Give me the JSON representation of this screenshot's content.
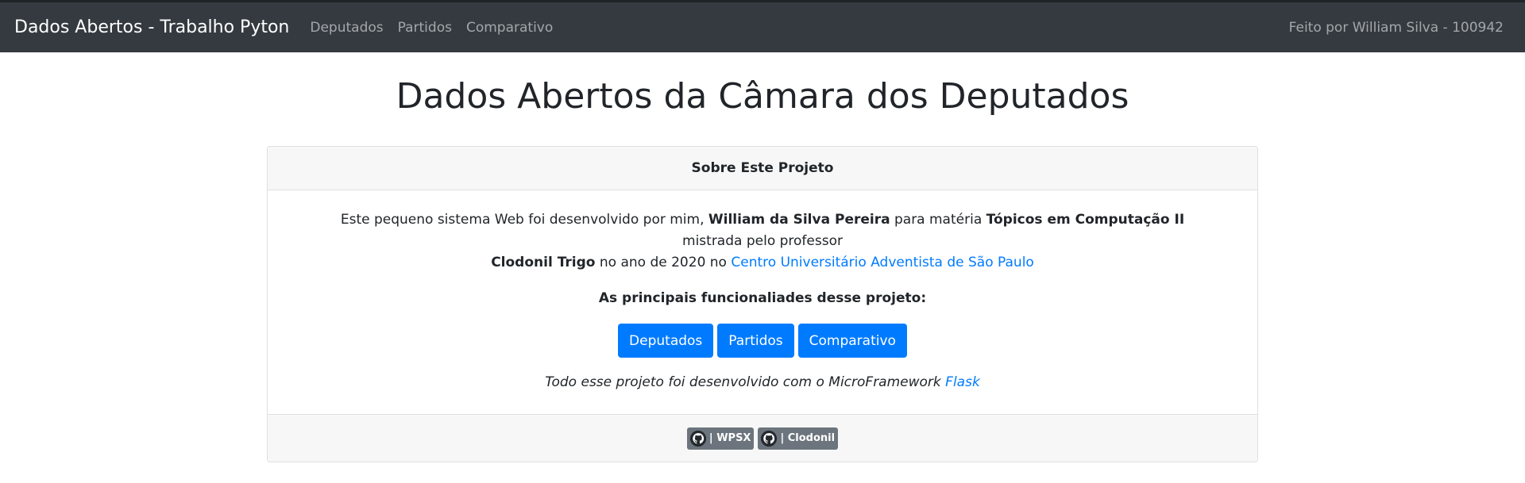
{
  "navbar": {
    "brand": "Dados Abertos - Trabalho Pyton",
    "links": [
      "Deputados",
      "Partidos",
      "Comparativo"
    ],
    "credit": "Feito por William Silva - 100942"
  },
  "page_title": "Dados Abertos da Câmara dos Deputados",
  "card": {
    "header": "Sobre Este Projeto",
    "intro": {
      "t1": "Este pequeno sistema Web foi desenvolvido por mim, ",
      "name": "William da Silva Pereira",
      "t2": " para matéria ",
      "course": "Tópicos em Computação II",
      "t3": " mistrada pelo professor ",
      "professor": "Clodonil Trigo",
      "t4": " no ano de 2020 no ",
      "university": "Centro Universitário Adventista de São Paulo"
    },
    "features_title": "As principais funcionaliades desse projeto:",
    "buttons": [
      "Deputados",
      "Partidos",
      "Comparativo"
    ],
    "outro": {
      "text": "Todo esse projeto foi desenvolvido com o MicroFramework ",
      "link": "Flask"
    },
    "footer_badges": [
      {
        "label": "| WPSX",
        "icon": "github-icon"
      },
      {
        "label": "| Clodonil",
        "icon": "github-icon"
      }
    ]
  },
  "colors": {
    "navbar_bg": "#343a40",
    "primary": "#007bff",
    "secondary": "#6c757d",
    "card_header_bg": "#f7f7f7"
  }
}
